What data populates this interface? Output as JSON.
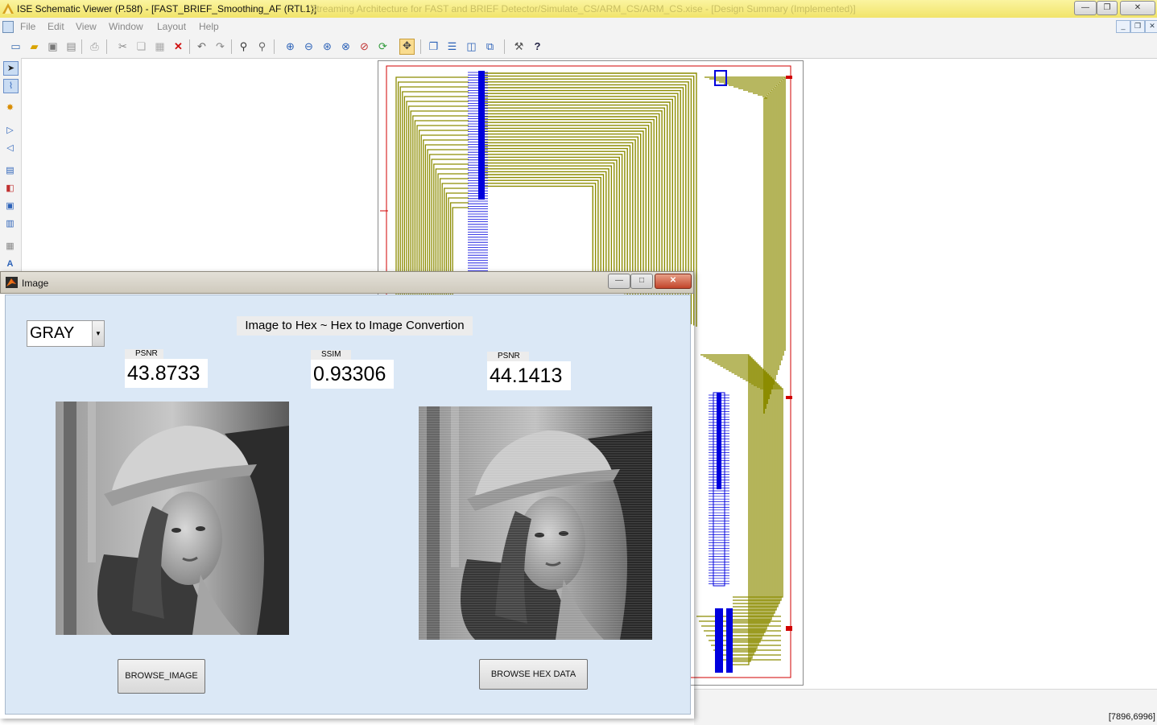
{
  "window": {
    "title": "ISE Schematic Viewer (P.58f) - [FAST_BRIEF_Smoothing_AF (RTL1)]",
    "title_ghost": "... Streaming Architecture for FAST and BRIEF Detector/Simulate_CS/ARM_CS/ARM_CS.xise - [Design Summary (Implemented)]"
  },
  "menu": [
    "File",
    "Edit",
    "View",
    "Window",
    "Layout",
    "Help"
  ],
  "toolbar": {
    "icons": [
      "new-icon",
      "open-icon",
      "save-icon",
      "save-all-icon",
      "print-icon",
      "cut-icon",
      "copy-icon",
      "paste-icon",
      "delete-icon",
      "undo-icon",
      "redo-icon",
      "find-icon",
      "find-next-icon",
      "zoom-in-icon",
      "zoom-out-icon",
      "zoom-full-icon",
      "zoom-to-selected-icon",
      "zoom-area-icon",
      "refresh-icon",
      "pan-icon",
      "cascade-icon",
      "tile-horizontal-icon",
      "tile-vertical-icon",
      "arrange-icon",
      "options-icon",
      "help-icon"
    ]
  },
  "left_toolbar": {
    "icons": [
      "select-icon",
      "route-icon",
      "add-instance-icon",
      "forward-icon",
      "back-icon",
      "hierarchy-icon",
      "push-icon",
      "pop-icon",
      "symbol-icon",
      "properties-icon",
      "text-icon"
    ]
  },
  "status": {
    "coords": "[7896,6996]"
  },
  "figure": {
    "title": "Image",
    "mode_select": "GRAY",
    "heading": "Image to Hex ~ Hex to Image Convertion",
    "metrics": [
      {
        "label": "PSNR",
        "value": "43.8733"
      },
      {
        "label": "SSIM",
        "value": "0.93306"
      },
      {
        "label": "PSNR",
        "value": "44.1413"
      }
    ],
    "buttons": {
      "browse_image": "BROWSE_IMAGE",
      "browse_hex": "BROWSE HEX DATA"
    }
  },
  "colors": {
    "schematic_wire": "#8c8c00",
    "schematic_pin": "#0000dd",
    "schematic_border": "#d00000",
    "figure_bg": "#dbe8f6"
  }
}
